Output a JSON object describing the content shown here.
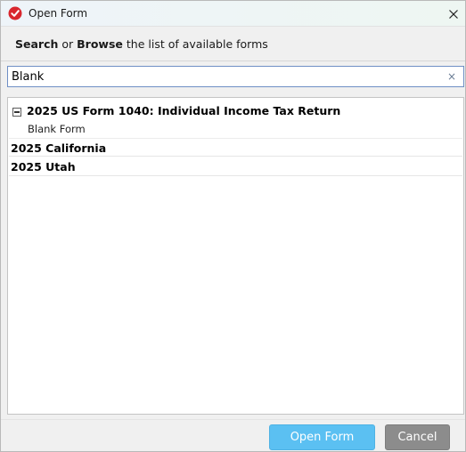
{
  "window": {
    "title": "Open Form",
    "accent_color": "#d9272e"
  },
  "instruction": {
    "search_word": "Search",
    "or_word": "or",
    "browse_word": "Browse",
    "rest": "the list of available forms"
  },
  "search": {
    "value": "Blank",
    "clear_glyph": "×"
  },
  "forms": {
    "items": [
      {
        "label": "2025 US Form 1040: Individual Income Tax Return",
        "expanded": true,
        "children": [
          {
            "label": "Blank Form"
          }
        ]
      },
      {
        "label": "2025 California"
      },
      {
        "label": "2025 Utah"
      }
    ]
  },
  "buttons": {
    "open": "Open Form",
    "cancel": "Cancel",
    "open_color": "#5bc0f2",
    "cancel_color": "#8c8c8c"
  }
}
